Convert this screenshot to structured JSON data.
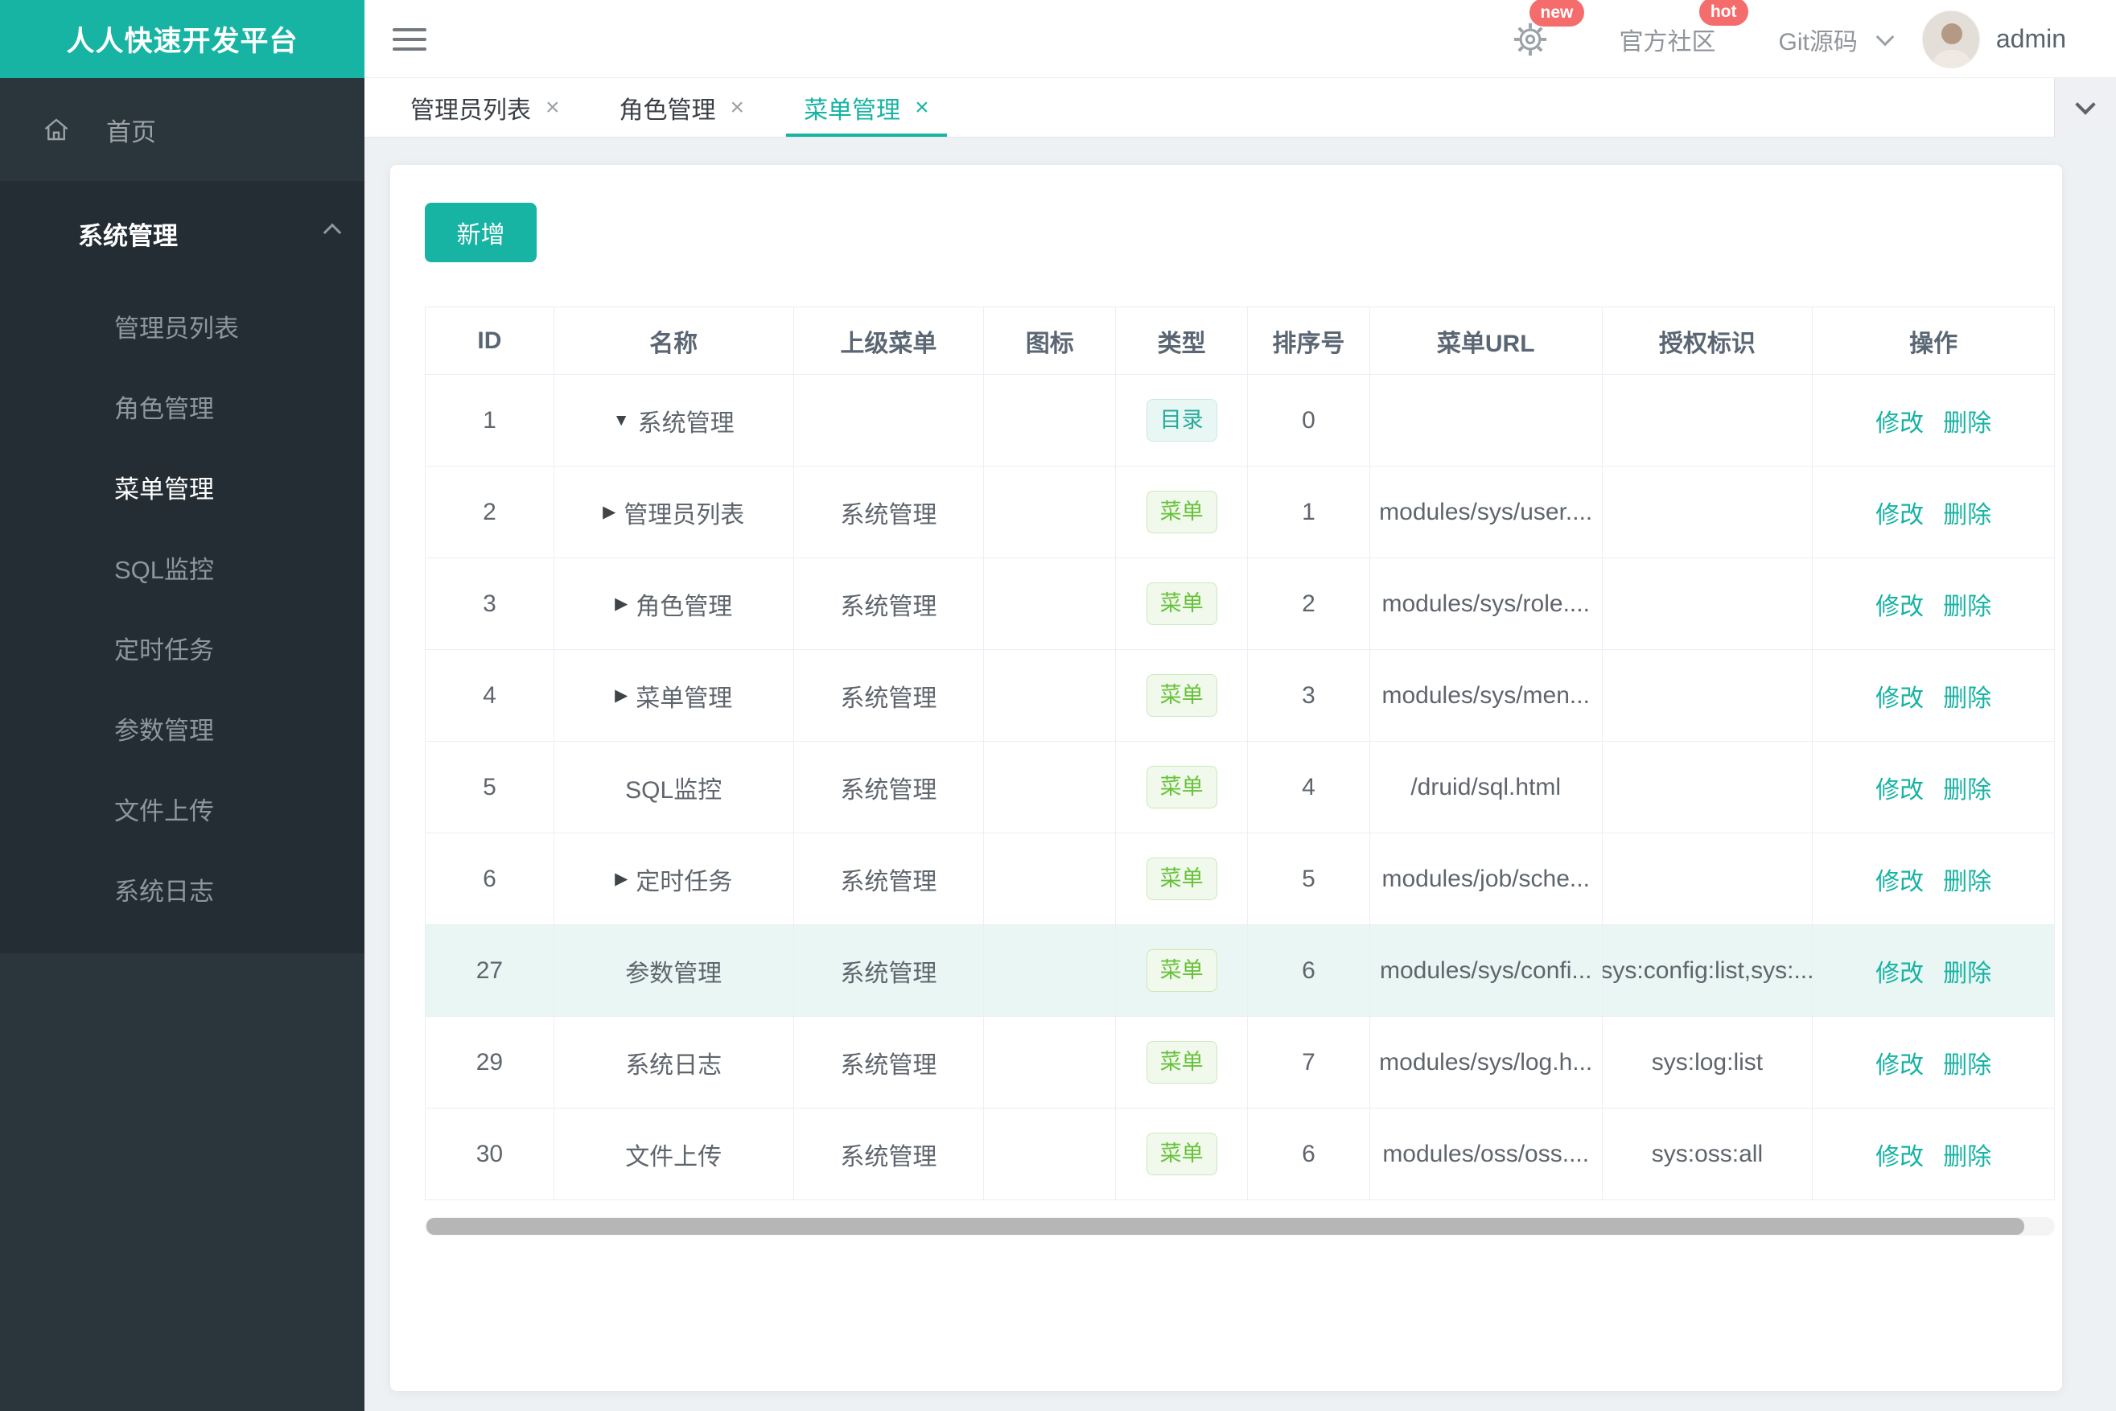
{
  "app": {
    "title": "人人快速开发平台"
  },
  "topbar": {
    "gear_badge": "new",
    "community": {
      "label": "官方社区",
      "badge": "hot"
    },
    "git": {
      "label": "Git源码"
    },
    "user": {
      "name": "admin"
    }
  },
  "sidebar": {
    "home": {
      "label": "首页"
    },
    "section": {
      "label": "系统管理",
      "items": [
        {
          "label": "管理员列表",
          "active": false
        },
        {
          "label": "角色管理",
          "active": false
        },
        {
          "label": "菜单管理",
          "active": true
        },
        {
          "label": "SQL监控",
          "active": false
        },
        {
          "label": "定时任务",
          "active": false
        },
        {
          "label": "参数管理",
          "active": false
        },
        {
          "label": "文件上传",
          "active": false
        },
        {
          "label": "系统日志",
          "active": false
        }
      ]
    }
  },
  "tabs": [
    {
      "label": "管理员列表",
      "active": false
    },
    {
      "label": "角色管理",
      "active": false
    },
    {
      "label": "菜单管理",
      "active": true
    }
  ],
  "toolbar": {
    "add_label": "新增"
  },
  "table": {
    "columns": [
      "ID",
      "名称",
      "上级菜单",
      "图标",
      "类型",
      "排序号",
      "菜单URL",
      "授权标识",
      "操作"
    ],
    "actions": [
      "修改",
      "删除"
    ],
    "rows": [
      {
        "id": "1",
        "arrow": "down",
        "name": "系统管理",
        "parent": "",
        "icon": "",
        "type": "目录",
        "type_kind": "dir",
        "order": "0",
        "url": "",
        "perms": "",
        "highlight": false
      },
      {
        "id": "2",
        "arrow": "right",
        "name": "管理员列表",
        "parent": "系统管理",
        "icon": "",
        "type": "菜单",
        "type_kind": "menu",
        "order": "1",
        "url": "modules/sys/user....",
        "perms": "",
        "highlight": false
      },
      {
        "id": "3",
        "arrow": "right",
        "name": "角色管理",
        "parent": "系统管理",
        "icon": "",
        "type": "菜单",
        "type_kind": "menu",
        "order": "2",
        "url": "modules/sys/role....",
        "perms": "",
        "highlight": false
      },
      {
        "id": "4",
        "arrow": "right",
        "name": "菜单管理",
        "parent": "系统管理",
        "icon": "",
        "type": "菜单",
        "type_kind": "menu",
        "order": "3",
        "url": "modules/sys/men...",
        "perms": "",
        "highlight": false
      },
      {
        "id": "5",
        "arrow": "none",
        "name": "SQL监控",
        "parent": "系统管理",
        "icon": "",
        "type": "菜单",
        "type_kind": "menu",
        "order": "4",
        "url": "/druid/sql.html",
        "perms": "",
        "highlight": false
      },
      {
        "id": "6",
        "arrow": "right",
        "name": "定时任务",
        "parent": "系统管理",
        "icon": "",
        "type": "菜单",
        "type_kind": "menu",
        "order": "5",
        "url": "modules/job/sche...",
        "perms": "",
        "highlight": false
      },
      {
        "id": "27",
        "arrow": "none",
        "name": "参数管理",
        "parent": "系统管理",
        "icon": "",
        "type": "菜单",
        "type_kind": "menu",
        "order": "6",
        "url": "modules/sys/confi...",
        "perms": "sys:config:list,sys:...",
        "highlight": true
      },
      {
        "id": "29",
        "arrow": "none",
        "name": "系统日志",
        "parent": "系统管理",
        "icon": "",
        "type": "菜单",
        "type_kind": "menu",
        "order": "7",
        "url": "modules/sys/log.h...",
        "perms": "sys:log:list",
        "highlight": false
      },
      {
        "id": "30",
        "arrow": "none",
        "name": "文件上传",
        "parent": "系统管理",
        "icon": "",
        "type": "菜单",
        "type_kind": "menu",
        "order": "6",
        "url": "modules/oss/oss....",
        "perms": "sys:oss:all",
        "highlight": false
      }
    ]
  },
  "colors": {
    "brand_teal": "#17b3a3",
    "badge_red": "#f56c6c",
    "tag_dir_text": "#23ab99",
    "tag_menu_text": "#67c23a",
    "sidebar_bg": "#2b353c",
    "sidebar_section_bg": "#242d33",
    "row_highlight": "#e9f6f3"
  }
}
